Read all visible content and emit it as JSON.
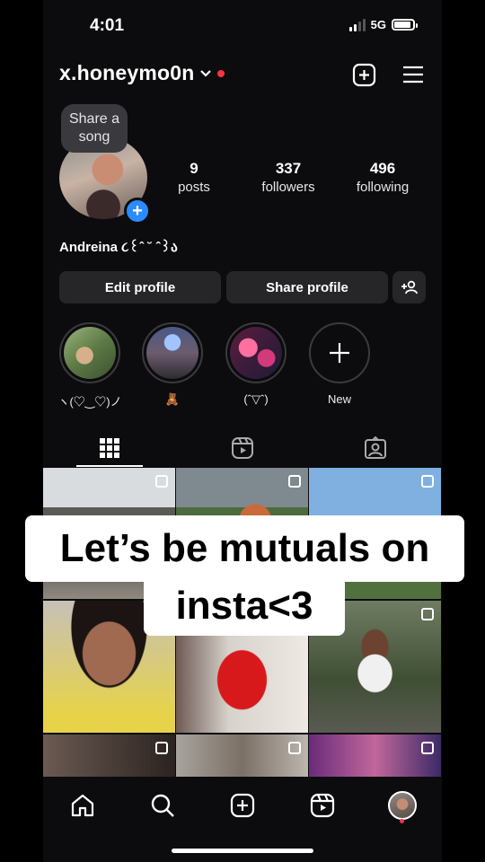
{
  "status_bar": {
    "time": "4:01",
    "network": "5G"
  },
  "header": {
    "username": "x.honeymo0n",
    "chevron_icon": "chevron-down-icon",
    "create_icon": "plus-square-icon",
    "menu_icon": "hamburger-menu-icon"
  },
  "profile": {
    "note": "Share a song",
    "stats": [
      {
        "value": "9",
        "label": "posts"
      },
      {
        "value": "337",
        "label": "followers"
      },
      {
        "value": "496",
        "label": "following"
      }
    ],
    "bio_name": "Andreina ૮꒰ˆ ˘ ˆ꒱ა"
  },
  "buttons": {
    "edit": "Edit profile",
    "share": "Share profile",
    "add_person_icon": "person-add-icon"
  },
  "highlights": [
    {
      "caption": "ヽ(♡‿♡)ノ"
    },
    {
      "caption": "🧸"
    },
    {
      "caption": "(ˆ▽ˆ)"
    },
    {
      "caption": "New"
    }
  ],
  "tabs": [
    "grid-icon",
    "reels-icon",
    "tagged-icon"
  ],
  "overlay": {
    "line1": "Let’s be mutuals on",
    "line2": "insta<3"
  },
  "nav": [
    "home-icon",
    "search-icon",
    "create-icon",
    "reels-icon",
    "profile-avatar"
  ],
  "colors": {
    "accent_blue": "#2b8bff",
    "notification_red": "#ff3040",
    "background": "#0c0c0e"
  }
}
